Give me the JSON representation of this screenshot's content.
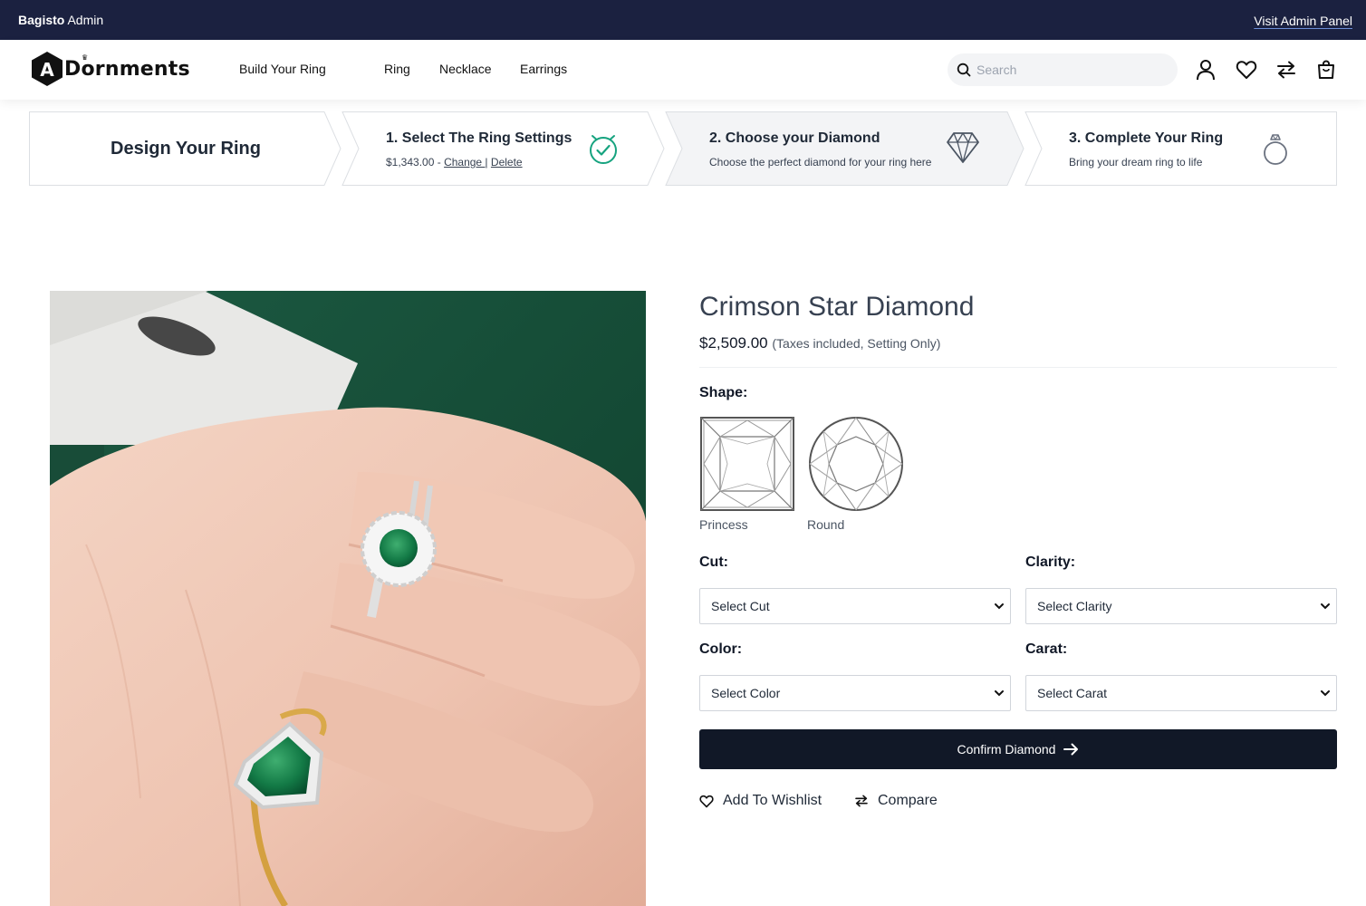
{
  "admin_bar": {
    "brand_bold": "Bagisto",
    "brand_rest": " Admin",
    "visit_link": "Visit Admin Panel"
  },
  "header": {
    "logo_text": "Dornments",
    "logo_letter": "A",
    "nav": [
      "Build Your Ring",
      "Ring",
      "Necklace",
      "Earrings"
    ],
    "search_placeholder": "Search",
    "icons": [
      "user-icon",
      "wishlist-heart-icon",
      "compare-icon",
      "cart-bag-icon"
    ]
  },
  "stepper": {
    "main_title": "Design Your Ring",
    "steps": [
      {
        "title": "1. Select The Ring Settings",
        "price": "$1,343.00 -",
        "change_link": "Change |",
        "delete_link": "Delete",
        "icon": "check-clock-icon"
      },
      {
        "title": "2. Choose your Diamond",
        "subtitle": "Choose the perfect diamond for your ring here",
        "icon": "diamond-icon"
      },
      {
        "title": "3. Complete Your Ring",
        "subtitle": "Bring your dream ring to life",
        "icon": "ring-icon"
      }
    ]
  },
  "product": {
    "title": "Crimson Star Diamond",
    "price": "$2,509.00",
    "price_note": "(Taxes included, Setting Only)",
    "image_alt": "ring-on-hand-photo"
  },
  "options": {
    "shape_label": "Shape:",
    "shapes": [
      "Princess",
      "Round"
    ],
    "cut_label": "Cut:",
    "cut_value": "Select Cut",
    "clarity_label": "Clarity:",
    "clarity_value": "Select Clarity",
    "color_label": "Color:",
    "color_value": "Select Color",
    "carat_label": "Carat:",
    "carat_value": "Select Carat"
  },
  "actions": {
    "confirm": "Confirm Diamond",
    "wishlist": "Add To Wishlist",
    "compare": "Compare"
  },
  "colors": {
    "admin_bar_bg": "#1b2140",
    "accent_green": "#16a37f",
    "button_dark": "#111827"
  }
}
